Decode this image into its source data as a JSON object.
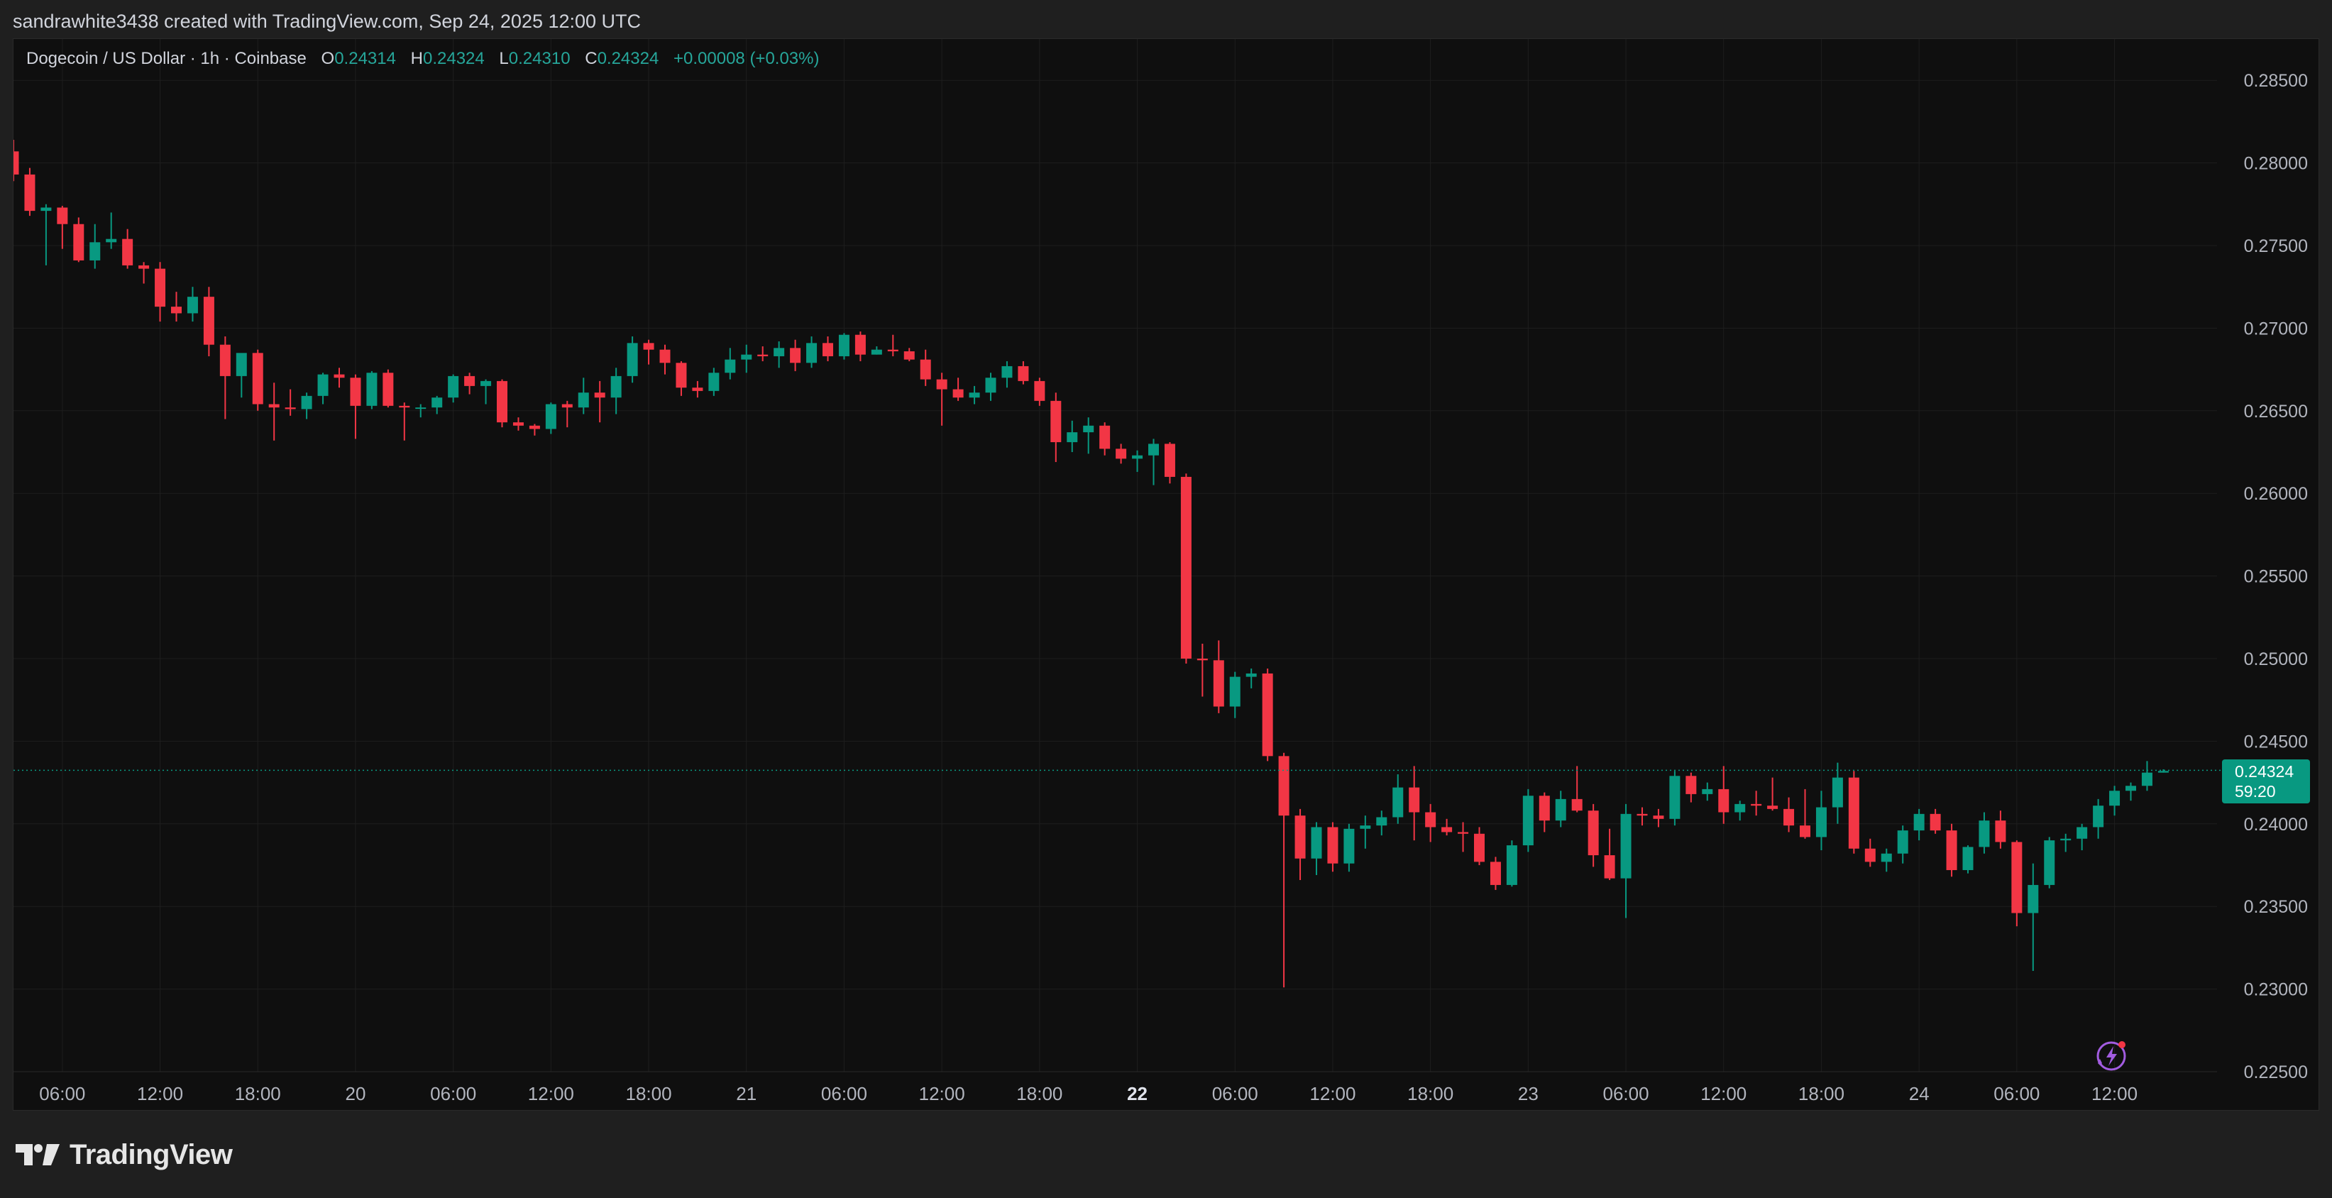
{
  "header": {
    "attribution": "sandrawhite3438 created with TradingView.com, Sep 24, 2025 12:00 UTC"
  },
  "legend": {
    "symbol": "Dogecoin / US Dollar · 1h · Coinbase",
    "open_label": "O",
    "open": "0.24314",
    "high_label": "H",
    "high": "0.24324",
    "low_label": "L",
    "low": "0.24310",
    "close_label": "C",
    "close": "0.24324",
    "change": "+0.00008 (+0.03%)"
  },
  "price_tag": {
    "price": "0.24324",
    "countdown": "59:20"
  },
  "footer": {
    "brand": "TradingView"
  },
  "colors": {
    "up": "#089981",
    "down": "#f23645",
    "background": "#0f0f0f",
    "grid": "#1e1e1e",
    "axis_text": "#b2b5be"
  },
  "chart_data": {
    "type": "candlestick",
    "interval": "1h",
    "symbol": "Dogecoin / US Dollar",
    "exchange": "Coinbase",
    "ylim": [
      0.225,
      0.2875
    ],
    "y_ticks": [
      "0.28500",
      "0.28000",
      "0.27500",
      "0.27000",
      "0.26500",
      "0.26000",
      "0.25500",
      "0.25000",
      "0.24500",
      "0.24000",
      "0.23500",
      "0.23000",
      "0.22500"
    ],
    "x_ticks": [
      {
        "label": "06:00",
        "index": 3,
        "bold": false
      },
      {
        "label": "12:00",
        "index": 9,
        "bold": false
      },
      {
        "label": "18:00",
        "index": 15,
        "bold": false
      },
      {
        "label": "20",
        "index": 21,
        "bold": false
      },
      {
        "label": "06:00",
        "index": 27,
        "bold": false
      },
      {
        "label": "12:00",
        "index": 33,
        "bold": false
      },
      {
        "label": "18:00",
        "index": 39,
        "bold": false
      },
      {
        "label": "21",
        "index": 45,
        "bold": false
      },
      {
        "label": "06:00",
        "index": 51,
        "bold": false
      },
      {
        "label": "12:00",
        "index": 57,
        "bold": false
      },
      {
        "label": "18:00",
        "index": 63,
        "bold": false
      },
      {
        "label": "22",
        "index": 69,
        "bold": true
      },
      {
        "label": "06:00",
        "index": 75,
        "bold": false
      },
      {
        "label": "12:00",
        "index": 81,
        "bold": false
      },
      {
        "label": "18:00",
        "index": 87,
        "bold": false
      },
      {
        "label": "23",
        "index": 93,
        "bold": false
      },
      {
        "label": "06:00",
        "index": 99,
        "bold": false
      },
      {
        "label": "12:00",
        "index": 105,
        "bold": false
      },
      {
        "label": "18:00",
        "index": 111,
        "bold": false
      },
      {
        "label": "24",
        "index": 117,
        "bold": false
      },
      {
        "label": "06:00",
        "index": 123,
        "bold": false
      },
      {
        "label": "12:00",
        "index": 129,
        "bold": false
      }
    ],
    "last_price": 0.24324,
    "candles": [
      [
        0.2807,
        0.2814,
        0.2789,
        0.2793
      ],
      [
        0.2793,
        0.2797,
        0.2768,
        0.2771
      ],
      [
        0.2771,
        0.2775,
        0.2738,
        0.2773
      ],
      [
        0.2773,
        0.2774,
        0.2748,
        0.2763
      ],
      [
        0.2763,
        0.2767,
        0.274,
        0.2741
      ],
      [
        0.2741,
        0.2763,
        0.2736,
        0.2752
      ],
      [
        0.2752,
        0.277,
        0.2748,
        0.2754
      ],
      [
        0.2754,
        0.276,
        0.2736,
        0.2738
      ],
      [
        0.2738,
        0.274,
        0.2727,
        0.2736
      ],
      [
        0.2736,
        0.274,
        0.2704,
        0.2713
      ],
      [
        0.2713,
        0.2722,
        0.2704,
        0.2709
      ],
      [
        0.2709,
        0.2725,
        0.2704,
        0.2719
      ],
      [
        0.2719,
        0.2725,
        0.2683,
        0.269
      ],
      [
        0.269,
        0.2695,
        0.2645,
        0.2671
      ],
      [
        0.2671,
        0.2684,
        0.2658,
        0.2685
      ],
      [
        0.2685,
        0.2687,
        0.265,
        0.2654
      ],
      [
        0.2654,
        0.2667,
        0.2632,
        0.2652
      ],
      [
        0.2652,
        0.2663,
        0.2647,
        0.2651
      ],
      [
        0.2651,
        0.2661,
        0.2645,
        0.2659
      ],
      [
        0.2659,
        0.2673,
        0.2654,
        0.2672
      ],
      [
        0.2672,
        0.2676,
        0.2664,
        0.267
      ],
      [
        0.267,
        0.2672,
        0.2633,
        0.2653
      ],
      [
        0.2653,
        0.2674,
        0.2651,
        0.2673
      ],
      [
        0.2673,
        0.2675,
        0.2652,
        0.2653
      ],
      [
        0.2653,
        0.2655,
        0.2632,
        0.2652
      ],
      [
        0.2652,
        0.2654,
        0.2646,
        0.2652
      ],
      [
        0.2652,
        0.2659,
        0.2648,
        0.2658
      ],
      [
        0.2658,
        0.2672,
        0.2655,
        0.2671
      ],
      [
        0.2671,
        0.2673,
        0.266,
        0.2665
      ],
      [
        0.2665,
        0.2669,
        0.2654,
        0.2668
      ],
      [
        0.2668,
        0.2669,
        0.264,
        0.2643
      ],
      [
        0.2643,
        0.2646,
        0.2638,
        0.2641
      ],
      [
        0.2641,
        0.2642,
        0.2635,
        0.2639
      ],
      [
        0.2639,
        0.2655,
        0.2636,
        0.2654
      ],
      [
        0.2654,
        0.2656,
        0.264,
        0.2652
      ],
      [
        0.2652,
        0.267,
        0.2648,
        0.2661
      ],
      [
        0.2661,
        0.2668,
        0.2643,
        0.2658
      ],
      [
        0.2658,
        0.2676,
        0.2648,
        0.2671
      ],
      [
        0.2671,
        0.2695,
        0.2667,
        0.2691
      ],
      [
        0.2691,
        0.2693,
        0.2678,
        0.2687
      ],
      [
        0.2687,
        0.269,
        0.2672,
        0.2679
      ],
      [
        0.2679,
        0.268,
        0.2659,
        0.2664
      ],
      [
        0.2664,
        0.2668,
        0.2658,
        0.2662
      ],
      [
        0.2662,
        0.2676,
        0.2659,
        0.2673
      ],
      [
        0.2673,
        0.2688,
        0.2669,
        0.2681
      ],
      [
        0.2681,
        0.269,
        0.2673,
        0.2684
      ],
      [
        0.2684,
        0.2689,
        0.268,
        0.2683
      ],
      [
        0.2683,
        0.2692,
        0.2676,
        0.2688
      ],
      [
        0.2688,
        0.2693,
        0.2674,
        0.2679
      ],
      [
        0.2679,
        0.2695,
        0.2676,
        0.2691
      ],
      [
        0.2691,
        0.2695,
        0.268,
        0.2683
      ],
      [
        0.2683,
        0.2697,
        0.2681,
        0.2696
      ],
      [
        0.2696,
        0.2698,
        0.268,
        0.2684
      ],
      [
        0.2684,
        0.2689,
        0.2684,
        0.2687
      ],
      [
        0.2687,
        0.2696,
        0.2683,
        0.2686
      ],
      [
        0.2686,
        0.2688,
        0.268,
        0.2681
      ],
      [
        0.2681,
        0.2687,
        0.2665,
        0.2669
      ],
      [
        0.2669,
        0.2673,
        0.2641,
        0.2663
      ],
      [
        0.2663,
        0.267,
        0.2656,
        0.2658
      ],
      [
        0.2658,
        0.2665,
        0.2654,
        0.2661
      ],
      [
        0.2661,
        0.2673,
        0.2656,
        0.267
      ],
      [
        0.267,
        0.268,
        0.2664,
        0.2677
      ],
      [
        0.2677,
        0.268,
        0.2666,
        0.2668
      ],
      [
        0.2668,
        0.267,
        0.2653,
        0.2656
      ],
      [
        0.2656,
        0.2661,
        0.2619,
        0.2631
      ],
      [
        0.2631,
        0.2644,
        0.2625,
        0.2637
      ],
      [
        0.2637,
        0.2646,
        0.2624,
        0.2641
      ],
      [
        0.2641,
        0.2643,
        0.2623,
        0.2627
      ],
      [
        0.2627,
        0.263,
        0.2618,
        0.2621
      ],
      [
        0.2621,
        0.2626,
        0.2613,
        0.2623
      ],
      [
        0.2623,
        0.2633,
        0.2605,
        0.263
      ],
      [
        0.263,
        0.2631,
        0.2606,
        0.261
      ],
      [
        0.261,
        0.2612,
        0.2497,
        0.25
      ],
      [
        0.25,
        0.2509,
        0.2477,
        0.2499
      ],
      [
        0.2499,
        0.2511,
        0.2467,
        0.2471
      ],
      [
        0.2471,
        0.2492,
        0.2464,
        0.2489
      ],
      [
        0.2489,
        0.2494,
        0.2482,
        0.2491
      ],
      [
        0.2491,
        0.2494,
        0.2438,
        0.2441
      ],
      [
        0.2441,
        0.2443,
        0.2301,
        0.2405
      ],
      [
        0.2405,
        0.2409,
        0.2366,
        0.2379
      ],
      [
        0.2379,
        0.2401,
        0.2369,
        0.2398
      ],
      [
        0.2398,
        0.2401,
        0.2371,
        0.2376
      ],
      [
        0.2376,
        0.24,
        0.2371,
        0.2397
      ],
      [
        0.2397,
        0.2405,
        0.2385,
        0.2399
      ],
      [
        0.2399,
        0.2408,
        0.2393,
        0.2404
      ],
      [
        0.2404,
        0.243,
        0.24,
        0.2422
      ],
      [
        0.2422,
        0.2435,
        0.239,
        0.2407
      ],
      [
        0.2407,
        0.2412,
        0.2389,
        0.2398
      ],
      [
        0.2398,
        0.2403,
        0.2393,
        0.2395
      ],
      [
        0.2395,
        0.2401,
        0.2383,
        0.2394
      ],
      [
        0.2394,
        0.2398,
        0.2375,
        0.2377
      ],
      [
        0.2377,
        0.238,
        0.236,
        0.2363
      ],
      [
        0.2363,
        0.239,
        0.2362,
        0.2387
      ],
      [
        0.2387,
        0.2421,
        0.2383,
        0.2417
      ],
      [
        0.2417,
        0.2419,
        0.2395,
        0.2402
      ],
      [
        0.2402,
        0.242,
        0.2398,
        0.2415
      ],
      [
        0.2415,
        0.2435,
        0.2407,
        0.2408
      ],
      [
        0.2408,
        0.2412,
        0.2374,
        0.2381
      ],
      [
        0.2381,
        0.2397,
        0.2366,
        0.2367
      ],
      [
        0.2367,
        0.2412,
        0.2343,
        0.2406
      ],
      [
        0.2406,
        0.241,
        0.2399,
        0.2405
      ],
      [
        0.2405,
        0.2409,
        0.2398,
        0.2403
      ],
      [
        0.2403,
        0.2432,
        0.2399,
        0.2429
      ],
      [
        0.2429,
        0.2431,
        0.2413,
        0.2418
      ],
      [
        0.2418,
        0.2425,
        0.2414,
        0.2421
      ],
      [
        0.2421,
        0.2435,
        0.24,
        0.2407
      ],
      [
        0.2407,
        0.2414,
        0.2402,
        0.2412
      ],
      [
        0.2412,
        0.242,
        0.2405,
        0.2411
      ],
      [
        0.2411,
        0.2428,
        0.2408,
        0.2409
      ],
      [
        0.2409,
        0.2416,
        0.2395,
        0.2399
      ],
      [
        0.2399,
        0.2421,
        0.2391,
        0.2392
      ],
      [
        0.2392,
        0.242,
        0.2384,
        0.241
      ],
      [
        0.241,
        0.2437,
        0.24,
        0.2428
      ],
      [
        0.2428,
        0.2432,
        0.2382,
        0.2385
      ],
      [
        0.2385,
        0.2391,
        0.2374,
        0.2377
      ],
      [
        0.2377,
        0.2385,
        0.2371,
        0.2382
      ],
      [
        0.2382,
        0.2399,
        0.2376,
        0.2396
      ],
      [
        0.2396,
        0.2409,
        0.239,
        0.2406
      ],
      [
        0.2406,
        0.2409,
        0.2394,
        0.2396
      ],
      [
        0.2396,
        0.24,
        0.2368,
        0.2372
      ],
      [
        0.2372,
        0.2387,
        0.237,
        0.2386
      ],
      [
        0.2386,
        0.2407,
        0.2382,
        0.2402
      ],
      [
        0.2402,
        0.2408,
        0.2385,
        0.2389
      ],
      [
        0.2389,
        0.239,
        0.2338,
        0.2346
      ],
      [
        0.2346,
        0.2376,
        0.2311,
        0.2363
      ],
      [
        0.2363,
        0.2392,
        0.2361,
        0.239
      ],
      [
        0.239,
        0.2394,
        0.2383,
        0.2391
      ],
      [
        0.2391,
        0.24,
        0.2384,
        0.2398
      ],
      [
        0.2398,
        0.2415,
        0.2391,
        0.2411
      ],
      [
        0.2411,
        0.2423,
        0.2405,
        0.242
      ],
      [
        0.242,
        0.2425,
        0.2414,
        0.2423
      ],
      [
        0.2423,
        0.2438,
        0.242,
        0.2431
      ],
      [
        0.2431,
        0.2433,
        0.2431,
        0.2432
      ]
    ]
  }
}
